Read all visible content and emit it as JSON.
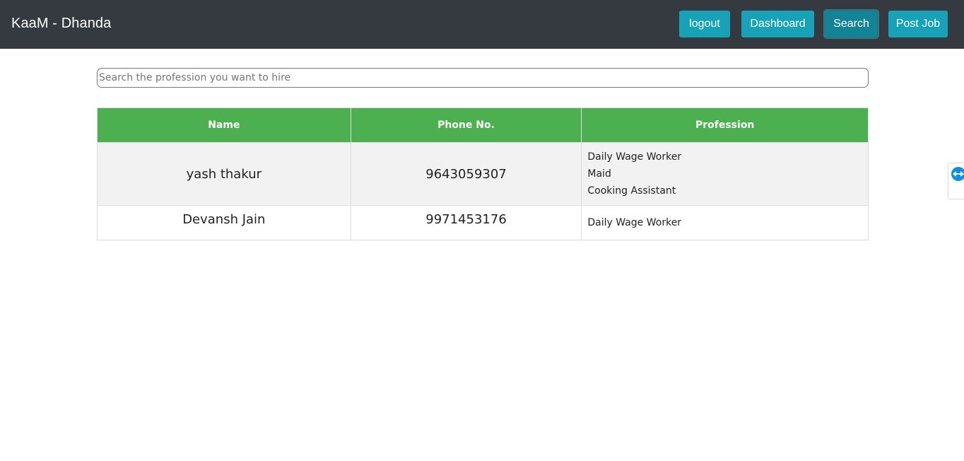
{
  "navbar": {
    "brand": "KaaM - Dhanda",
    "buttons": [
      {
        "label": "logout"
      },
      {
        "label": "Dashboard"
      },
      {
        "label": "Search",
        "active": true
      },
      {
        "label": "Post Job"
      }
    ]
  },
  "search": {
    "placeholder": "Search the profession you want to hire",
    "value": ""
  },
  "table": {
    "headers": [
      "Name",
      "Phone No.",
      "Profession"
    ],
    "rows": [
      {
        "name": "yash thakur",
        "phone": "9643059307",
        "professions": [
          "Daily Wage Worker",
          "Maid",
          "Cooking Assistant"
        ]
      },
      {
        "name": "Devansh Jain",
        "phone": "9971453176",
        "professions": [
          "Daily Wage Worker"
        ]
      }
    ]
  },
  "colors": {
    "navbar_bg": "#343a40",
    "button_bg": "#17a2b8",
    "table_header_bg": "#4caf50"
  },
  "icons": {
    "side_tab": "teamviewer-icon"
  }
}
